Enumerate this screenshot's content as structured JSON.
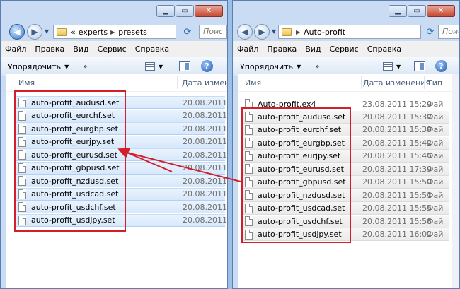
{
  "left_window": {
    "address": {
      "parts": [
        "«",
        "experts",
        "presets"
      ]
    },
    "search_placeholder": "Поис",
    "menu": [
      "Файл",
      "Правка",
      "Вид",
      "Сервис",
      "Справка"
    ],
    "toolbar": {
      "organize": "Упорядочить",
      "more": "»"
    },
    "columns": {
      "name": "Имя",
      "date": "Дата измене"
    },
    "files": [
      {
        "name": "auto-profit_audusd.set",
        "date": "20.08.2011 1"
      },
      {
        "name": "auto-profit_eurchf.set",
        "date": "20.08.2011 1"
      },
      {
        "name": "auto-profit_eurgbp.set",
        "date": "20.08.2011 1"
      },
      {
        "name": "auto-profit_eurjpy.set",
        "date": "20.08.2011 1"
      },
      {
        "name": "auto-profit_eurusd.set",
        "date": "20.08.2011 1"
      },
      {
        "name": "auto-profit_gbpusd.set",
        "date": "20.08.2011 1"
      },
      {
        "name": "auto-profit_nzdusd.set",
        "date": "20.08.2011 1"
      },
      {
        "name": "auto-profit_usdcad.set",
        "date": "20.08.2011 1"
      },
      {
        "name": "auto-profit_usdchf.set",
        "date": "20.08.2011 1"
      },
      {
        "name": "auto-profit_usdjpy.set",
        "date": "20.08.2011 1"
      }
    ]
  },
  "right_window": {
    "address": {
      "parts": [
        "Auto-profit"
      ]
    },
    "search_placeholder": "Поис",
    "menu": [
      "Файл",
      "Правка",
      "Вид",
      "Сервис",
      "Справка"
    ],
    "toolbar": {
      "organize": "Упорядочить",
      "more": "»"
    },
    "columns": {
      "name": "Имя",
      "date": "Дата изменения",
      "type": "Тип"
    },
    "files": [
      {
        "name": "Auto-profit.ex4",
        "date": "23.08.2011 15:29",
        "type": "Фай"
      },
      {
        "name": "auto-profit_audusd.set",
        "date": "20.08.2011 15:32",
        "type": "Фай"
      },
      {
        "name": "auto-profit_eurchf.set",
        "date": "20.08.2011 15:39",
        "type": "Фай"
      },
      {
        "name": "auto-profit_eurgbp.set",
        "date": "20.08.2011 15:42",
        "type": "Фай"
      },
      {
        "name": "auto-profit_eurjpy.set",
        "date": "20.08.2011 15:45",
        "type": "Фай"
      },
      {
        "name": "auto-profit_eurusd.set",
        "date": "20.08.2011 17:39",
        "type": "Фай"
      },
      {
        "name": "auto-profit_gbpusd.set",
        "date": "20.08.2011 15:50",
        "type": "Фай"
      },
      {
        "name": "auto-profit_nzdusd.set",
        "date": "20.08.2011 15:51",
        "type": "Фай"
      },
      {
        "name": "auto-profit_usdcad.set",
        "date": "20.08.2011 15:55",
        "type": "Фай"
      },
      {
        "name": "auto-profit_usdchf.set",
        "date": "20.08.2011 15:58",
        "type": "Фай"
      },
      {
        "name": "auto-profit_usdjpy.set",
        "date": "20.08.2011 16:02",
        "type": "Фай"
      }
    ]
  },
  "colors": {
    "annotation_red": "#d21f2b",
    "selection": "#d7e8fb",
    "window_frame": "#c9dcf3"
  },
  "icons": [
    "back-arrow-icon",
    "forward-arrow-icon",
    "folder-icon",
    "refresh-icon",
    "view-icon",
    "preview-pane-icon",
    "help-icon",
    "file-icon"
  ]
}
